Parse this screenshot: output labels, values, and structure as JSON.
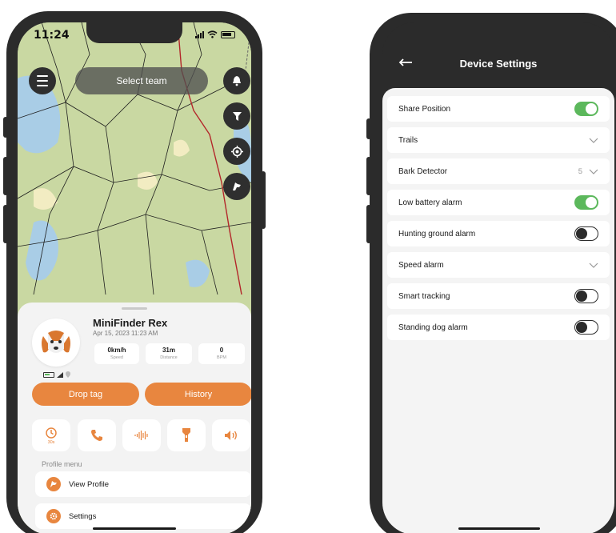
{
  "left_phone": {
    "status": {
      "time": "11:24"
    },
    "map": {
      "select_team_label": "Select team"
    },
    "profile": {
      "name": "MiniFinder Rex",
      "date": "Apr 15, 2023 11:23 AM",
      "stats": [
        {
          "value": "0km/h",
          "label": "Speed"
        },
        {
          "value": "31m",
          "label": "Distance"
        },
        {
          "value": "0",
          "label": "BPM"
        }
      ]
    },
    "buttons": {
      "drop_tag": "Drop tag",
      "history": "History"
    },
    "actions": [
      {
        "icon": "timer-icon",
        "sub": "30s"
      },
      {
        "icon": "phone-icon",
        "sub": ""
      },
      {
        "icon": "sound-wave-icon",
        "sub": ""
      },
      {
        "icon": "flashlight-icon",
        "sub": ""
      },
      {
        "icon": "speaker-icon",
        "sub": ""
      }
    ],
    "profile_menu": {
      "label": "Profile menu",
      "items": [
        {
          "label": "View Profile",
          "icon": "dog-head-icon"
        },
        {
          "label": "Settings",
          "icon": "gear-icon"
        }
      ]
    },
    "colors": {
      "accent": "#e8863f",
      "dark": "#2f2f2f",
      "map_green": "#c9d8a2",
      "water": "#a9cde6"
    }
  },
  "right_phone": {
    "title": "Device Settings",
    "settings": [
      {
        "label": "Share Position",
        "control": "toggle",
        "state": "on"
      },
      {
        "label": "Trails",
        "control": "dropdown",
        "value": ""
      },
      {
        "label": "Bark Detector",
        "control": "dropdown",
        "value": "5"
      },
      {
        "label": "Low battery alarm",
        "control": "toggle",
        "state": "on"
      },
      {
        "label": "Hunting ground alarm",
        "control": "toggle",
        "state": "off"
      },
      {
        "label": "Speed alarm",
        "control": "dropdown",
        "value": ""
      },
      {
        "label": "Smart tracking",
        "control": "toggle",
        "state": "off"
      },
      {
        "label": "Standing dog alarm",
        "control": "toggle",
        "state": "off"
      }
    ],
    "colors": {
      "toggle_on": "#5cb85c",
      "header": "#2b2b2b"
    }
  }
}
